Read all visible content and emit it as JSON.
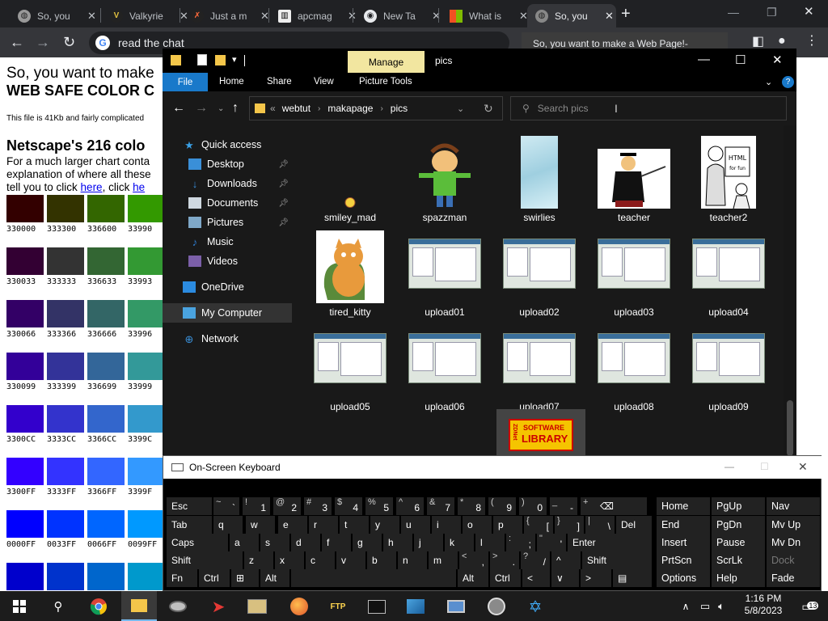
{
  "browser": {
    "tabs": [
      {
        "title": "So, you",
        "icon": "apcmag-globe-icon",
        "active": false
      },
      {
        "title": "Valkyrie",
        "icon": "valkyrie-icon",
        "active": false
      },
      {
        "title": "Just a m",
        "icon": "fish-icon",
        "active": false
      },
      {
        "title": "apcmag",
        "icon": "apcmag-icon",
        "active": false
      },
      {
        "title": "New Ta",
        "icon": "chrome-icon",
        "active": false
      },
      {
        "title": "What is",
        "icon": "microsoft-icon",
        "active": false
      },
      {
        "title": "So, you",
        "icon": "globe-icon",
        "active": true
      }
    ],
    "address": "read the chat",
    "tooltip": "So, you want to make a Web Page!-"
  },
  "webpage": {
    "title": "So, you want to make",
    "subtitle": "WEB SAFE COLOR C",
    "size_note": "This file is 41Kb and fairly complicated",
    "heading": "Netscape's 216 colo",
    "para1": "For a much larger chart conta",
    "para2": "explanation of where all these",
    "para3_prefix": "tell you to click ",
    "link1": "here",
    "para3_mid": ", click ",
    "link2": "he",
    "swatch_rows": [
      {
        "colors": [
          "#330000",
          "#333300",
          "#336600",
          "#339900"
        ],
        "labels": [
          "330000",
          "333300",
          "336600",
          "33990"
        ]
      },
      {
        "colors": [
          "#330033",
          "#333333",
          "#336633",
          "#339933"
        ],
        "labels": [
          "330033",
          "333333",
          "336633",
          "33993"
        ]
      },
      {
        "colors": [
          "#330066",
          "#333366",
          "#336666",
          "#339966"
        ],
        "labels": [
          "330066",
          "333366",
          "336666",
          "33996"
        ]
      },
      {
        "colors": [
          "#330099",
          "#333399",
          "#336699",
          "#339999"
        ],
        "labels": [
          "330099",
          "333399",
          "336699",
          "33999"
        ]
      },
      {
        "colors": [
          "#3300CC",
          "#3333CC",
          "#3366CC",
          "#3399CC"
        ],
        "labels": [
          "3300CC",
          "3333CC",
          "3366CC",
          "3399C"
        ]
      },
      {
        "colors": [
          "#3300FF",
          "#3333FF",
          "#3366FF",
          "#3399FF"
        ],
        "labels": [
          "3300FF",
          "3333FF",
          "3366FF",
          "3399F"
        ]
      },
      {
        "colors": [
          "#0000FF",
          "#0033FF",
          "#0066FF",
          "#0099FF"
        ],
        "labels": [
          "0000FF",
          "0033FF",
          "0066FF",
          "0099FF"
        ]
      },
      {
        "colors": [
          "#0000CC",
          "#0033CC",
          "#0066CC",
          "#0099CC"
        ],
        "labels": [
          "",
          "",
          "",
          ""
        ]
      }
    ]
  },
  "explorer": {
    "manage_tab": "Manage",
    "window_title": "pics",
    "ribbon_tabs": [
      "File",
      "Home",
      "Share",
      "View",
      "Picture Tools"
    ],
    "breadcrumb": [
      "webtut",
      "makapage",
      "pics"
    ],
    "search_placeholder": "Search pics",
    "nav": [
      {
        "label": "Quick access",
        "icon": "star-icon",
        "pinned": false
      },
      {
        "label": "Desktop",
        "icon": "desktop-icon",
        "pinned": true
      },
      {
        "label": "Downloads",
        "icon": "download-icon",
        "pinned": true
      },
      {
        "label": "Documents",
        "icon": "documents-icon",
        "pinned": true
      },
      {
        "label": "Pictures",
        "icon": "pictures-icon",
        "pinned": true
      },
      {
        "label": "Music",
        "icon": "music-icon",
        "pinned": false
      },
      {
        "label": "Videos",
        "icon": "videos-icon",
        "pinned": false
      },
      {
        "label": "OneDrive",
        "icon": "cloud-icon",
        "pinned": false
      },
      {
        "label": "My Computer",
        "icon": "computer-icon",
        "pinned": false
      },
      {
        "label": "Network",
        "icon": "network-icon",
        "pinned": false
      }
    ],
    "files": [
      {
        "name": "smiley_mad",
        "kind": "smiley"
      },
      {
        "name": "spazzman",
        "kind": "cartoon"
      },
      {
        "name": "swirlies",
        "kind": "swirl"
      },
      {
        "name": "teacher",
        "kind": "teacher"
      },
      {
        "name": "teacher2",
        "kind": "sketch"
      },
      {
        "name": "tired_kitty",
        "kind": "cat"
      },
      {
        "name": "upload01",
        "kind": "shot"
      },
      {
        "name": "upload02",
        "kind": "shot"
      },
      {
        "name": "upload03",
        "kind": "shot"
      },
      {
        "name": "upload04",
        "kind": "shot"
      },
      {
        "name": "upload05",
        "kind": "shot"
      },
      {
        "name": "upload06",
        "kind": "shot"
      },
      {
        "name": "upload07",
        "kind": "shot"
      },
      {
        "name": "upload08",
        "kind": "shot"
      },
      {
        "name": "upload09",
        "kind": "shot"
      },
      {
        "name": "",
        "kind": "partial"
      },
      {
        "name": "",
        "kind": "bw"
      },
      {
        "name": "",
        "kind": "library"
      }
    ],
    "library_label_top": "SOFTWARE",
    "library_label_bottom": "LIBRARY",
    "library_side": "ZDNet",
    "sketch_text": "HTML for fun n profit"
  },
  "osk": {
    "title": "On-Screen Keyboard",
    "rows": [
      [
        {
          "main": "Esc"
        },
        {
          "sup": "~",
          "main": "`"
        },
        {
          "sup": "!",
          "main": "1"
        },
        {
          "sup": "@",
          "main": "2"
        },
        {
          "sup": "#",
          "main": "3"
        },
        {
          "sup": "$",
          "main": "4"
        },
        {
          "sup": "%",
          "main": "5"
        },
        {
          "sup": "^",
          "main": "6"
        },
        {
          "sup": "&",
          "main": "7"
        },
        {
          "sup": "*",
          "main": "8"
        },
        {
          "sup": "(",
          "main": "9"
        },
        {
          "sup": ")",
          "main": "0"
        },
        {
          "sup": "_",
          "main": "-"
        },
        {
          "sup": "+",
          "main": "="
        },
        {
          "main": "⌫"
        }
      ],
      [
        {
          "main": "Tab"
        },
        {
          "main": "q"
        },
        {
          "main": "w"
        },
        {
          "main": "e"
        },
        {
          "main": "r"
        },
        {
          "main": "t"
        },
        {
          "main": "y"
        },
        {
          "main": "u"
        },
        {
          "main": "i"
        },
        {
          "main": "o"
        },
        {
          "main": "p"
        },
        {
          "sup": "{",
          "main": "["
        },
        {
          "sup": "}",
          "main": "]"
        },
        {
          "sup": "|",
          "main": "\\"
        },
        {
          "main": "Del"
        }
      ],
      [
        {
          "main": "Caps"
        },
        {
          "main": "a"
        },
        {
          "main": "s"
        },
        {
          "main": "d"
        },
        {
          "main": "f"
        },
        {
          "main": "g"
        },
        {
          "main": "h"
        },
        {
          "main": "j"
        },
        {
          "main": "k"
        },
        {
          "main": "l"
        },
        {
          "sup": ":",
          "main": ";"
        },
        {
          "sup": "\"",
          "main": "'"
        },
        {
          "main": "Enter"
        }
      ],
      [
        {
          "main": "Shift"
        },
        {
          "main": "z"
        },
        {
          "main": "x"
        },
        {
          "main": "c"
        },
        {
          "main": "v"
        },
        {
          "main": "b"
        },
        {
          "main": "n"
        },
        {
          "main": "m"
        },
        {
          "sup": "<",
          "main": ","
        },
        {
          "sup": ">",
          "main": "."
        },
        {
          "sup": "?",
          "main": "/"
        },
        {
          "main": "^"
        },
        {
          "main": "Shift"
        }
      ],
      [
        {
          "main": "Fn"
        },
        {
          "main": "Ctrl"
        },
        {
          "main": "⊞"
        },
        {
          "main": "Alt"
        },
        {
          "main": ""
        },
        {
          "main": "Alt"
        },
        {
          "main": "Ctrl"
        },
        {
          "main": "<"
        },
        {
          "main": "∨"
        },
        {
          "main": ">"
        },
        {
          "main": "▤"
        }
      ]
    ],
    "nav_keys": [
      [
        "Home",
        "PgUp",
        "Nav"
      ],
      [
        "End",
        "PgDn",
        "Mv Up"
      ],
      [
        "Insert",
        "Pause",
        "Mv Dn"
      ],
      [
        "PrtScn",
        "ScrLk",
        "Dock"
      ],
      [
        "Options",
        "Help",
        "Fade"
      ]
    ]
  },
  "taskbar": {
    "apps": [
      "windows-start-icon",
      "search-icon",
      "chrome-icon",
      "file-explorer-icon",
      "disk-icon",
      "rocket-icon",
      "video-app-icon",
      "firefox-icon",
      "ftp-icon",
      "terminal-icon",
      "photos-icon",
      "monitor-icon",
      "globe-app-icon",
      "atom-icon"
    ],
    "ftp_label": "FTP",
    "time": "1:16 PM",
    "date": "5/8/2023",
    "notification_count": "13"
  }
}
